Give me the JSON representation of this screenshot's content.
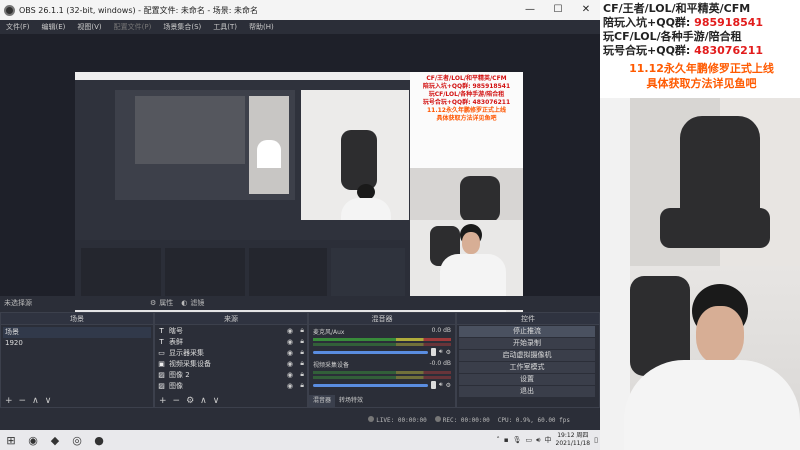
{
  "titlebar": {
    "title": "OBS 26.1.1 (32-bit, windows) - 配置文件: 未命名 - 场景: 未命名",
    "minimize": "—",
    "maximize": "☐",
    "close": "✕"
  },
  "menu": {
    "items": [
      "文件(F)",
      "编辑(E)",
      "视图(V)",
      "配置文件(P)",
      "场景集合(S)",
      "工具(T)",
      "帮助(H)"
    ]
  },
  "status_row": {
    "no_source": "未选择源",
    "properties": "属性",
    "filters": "滤镜"
  },
  "scenes": {
    "header": "场景",
    "items": [
      "场景",
      "1920"
    ]
  },
  "sources": {
    "header": "来源",
    "items": [
      {
        "icon": "T",
        "label": "瞎号"
      },
      {
        "icon": "T",
        "label": "表鲜"
      },
      {
        "icon": "▭",
        "label": "显示器采集"
      },
      {
        "icon": "▣",
        "label": "视频采集设备"
      },
      {
        "icon": "▨",
        "label": "图像 2"
      },
      {
        "icon": "▨",
        "label": "图像"
      }
    ]
  },
  "mixer": {
    "header": "混音器",
    "ch1": {
      "name": "麦克风/Aux",
      "db": "0.0 dB"
    },
    "ch2": {
      "name": "视频采集设备",
      "db": "-0.0 dB"
    },
    "tab_mixer": "混音器",
    "tab_transitions": "转场特效"
  },
  "controls": {
    "header": "控件",
    "buttons": [
      "停止推流",
      "开始录制",
      "启动虚拟摄像机",
      "工作室模式",
      "设置",
      "退出"
    ]
  },
  "statusbar": {
    "live": "LIVE: 00:00:00",
    "rec": "REC: 00:00:00",
    "cpu": "CPU: 0.9%, 60.00 fps"
  },
  "footer_icons": {
    "add": "+",
    "remove": "−",
    "gear": "⚙",
    "up": "∧",
    "down": "∨"
  },
  "taskbar": {
    "clock_time": "19:12 周四",
    "clock_date": "2021/11/18",
    "ime": "中"
  },
  "overlay_small": {
    "line1": "CF/王者/LOL/和平精英/CFM",
    "line2": "陪玩入坑+QQ群: 985918541",
    "line3": "玩CF/LOL/各种手游/陪合租",
    "line4": "玩号合玩+QQ群: 483076211",
    "line5": "11.12永久年鹏修罗正式上线",
    "line6": "具体获取方法详见鱼吧"
  },
  "overlay_side": {
    "line1": "CF/王者/LOL/和平精英/CFM",
    "line2a": "陪玩入坑+QQ群:",
    "line2b": "985918541",
    "line3": "玩CF/LOL/各种手游/陪合租",
    "line4a": "玩号合玩+QQ群:",
    "line4b": "483076211",
    "line5": "11.12永久年鹏修罗正式上线",
    "line6": "具体获取方法详见鱼吧"
  }
}
